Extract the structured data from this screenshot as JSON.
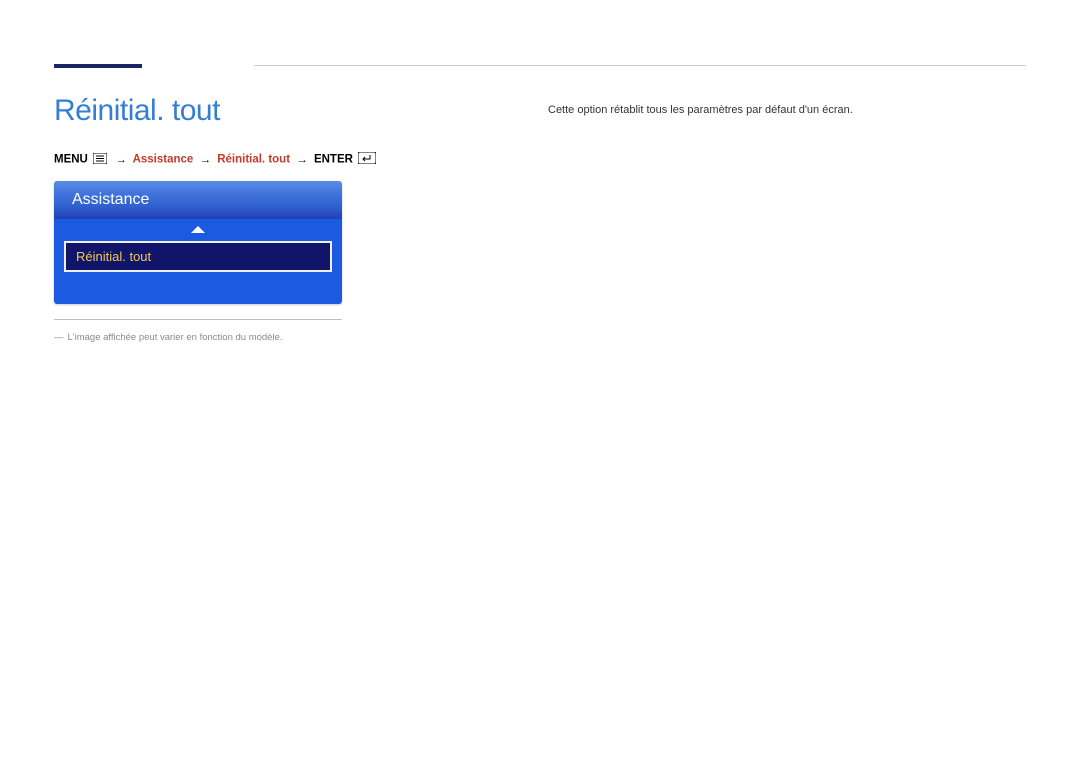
{
  "title": "Réinitial. tout",
  "breadcrumb": {
    "menu_label": "MENU",
    "arrow": "→",
    "path1": "Assistance",
    "path2": "Réinitial. tout",
    "enter_label": "ENTER"
  },
  "panel": {
    "header": "Assistance",
    "item": "Réinitial. tout"
  },
  "disclaimer": "L'image affichée peut varier en fonction du modèle.",
  "description": "Cette option rétablit tous les paramètres par défaut d'un écran."
}
